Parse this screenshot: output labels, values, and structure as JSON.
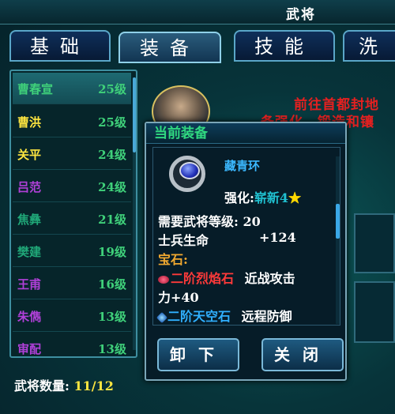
{
  "window": {
    "title": "武将"
  },
  "tabs": [
    {
      "label": "基础"
    },
    {
      "label": "装备"
    },
    {
      "label": "技能"
    },
    {
      "label": "洗"
    }
  ],
  "generals": [
    {
      "name": "曹春宣",
      "level": "25级",
      "color": "#3fd07a"
    },
    {
      "name": "曹洪",
      "level": "25级",
      "color": "#ffe640"
    },
    {
      "name": "关平",
      "level": "24级",
      "color": "#ffe640"
    },
    {
      "name": "吕范",
      "level": "24级",
      "color": "#b040d8"
    },
    {
      "name": "焦彝",
      "level": "21级",
      "color": "#20a878"
    },
    {
      "name": "樊建",
      "level": "19级",
      "color": "#20a878"
    },
    {
      "name": "王甫",
      "level": "16级",
      "color": "#b040d8"
    },
    {
      "name": "朱儁",
      "level": "13级",
      "color": "#b040d8"
    },
    {
      "name": "审配",
      "level": "13级",
      "color": "#b040d8"
    }
  ],
  "general_count": {
    "label": "武将数量:",
    "value": "11/12"
  },
  "notice": {
    "line1": "前往首都封地",
    "line2": "备强化、锻造和镶"
  },
  "equip_panel": {
    "title": "当前装备",
    "item_name": "藏青环",
    "enhance_label": "强化:",
    "enhance_value": "崭新4",
    "enhance_star": "★",
    "req_label": "需要武将等级:",
    "req_value": "20",
    "stat_label": "士兵生命",
    "stat_value": "+124",
    "gem_label": "宝石:",
    "gem1_name": "二阶烈焰石",
    "gem1_effect": "近战攻击",
    "gem1_value": "力+40",
    "gem2_name": "二阶天空石",
    "gem2_effect": "远程防御"
  },
  "buttons": {
    "unequip": "卸下",
    "close": "关闭"
  },
  "colors": {
    "accent_border": "#5aa6c8",
    "title_green": "#30d880",
    "notice_red": "#e42020"
  }
}
